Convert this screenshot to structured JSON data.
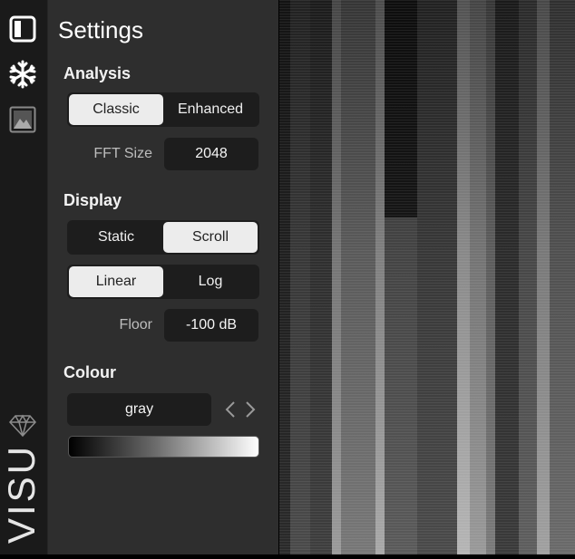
{
  "sidebar": {
    "icons": [
      "panel-toggle-icon",
      "snowflake-icon",
      "image-icon",
      "diamond-icon"
    ],
    "brand": "VISU"
  },
  "settings": {
    "title": "Settings",
    "analysis": {
      "heading": "Analysis",
      "modes": [
        "Classic",
        "Enhanced"
      ],
      "selected_mode": "Classic",
      "fft_label": "FFT Size",
      "fft_value": "2048"
    },
    "display": {
      "heading": "Display",
      "scroll_modes": [
        "Static",
        "Scroll"
      ],
      "selected_scroll": "Scroll",
      "scale_modes": [
        "Linear",
        "Log"
      ],
      "selected_scale": "Linear",
      "floor_label": "Floor",
      "floor_value": "-100 dB"
    },
    "colour": {
      "heading": "Colour",
      "selected": "gray",
      "gradient_colors": [
        "#000000",
        "#ffffff"
      ]
    }
  },
  "colors": {
    "panel_bg": "#2e2e2e",
    "iconbar_bg": "#1a1a1a",
    "control_bg": "#1d1d1d",
    "active_bg": "#ececec"
  }
}
